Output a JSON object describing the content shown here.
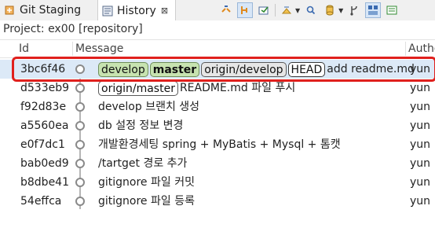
{
  "tabs": [
    {
      "label": "Git Staging"
    },
    {
      "label": "History",
      "close": "⊠"
    }
  ],
  "project": {
    "text": "Project: ex00 [repository]"
  },
  "table": {
    "columns": {
      "id": "Id",
      "message": "Message",
      "author": "Autho"
    },
    "rows": [
      {
        "id": "3bc6f46",
        "message": "add readme.md",
        "author": "yun"
      },
      {
        "id": "d533eb9",
        "message": "README.md 파일 푸시",
        "author": "yun"
      },
      {
        "id": "f92d83e",
        "message": "develop 브랜치 생성",
        "author": "yun"
      },
      {
        "id": "a5560ea",
        "message": "db 설정 정보 변경",
        "author": "yun"
      },
      {
        "id": "e0f7dc1",
        "message": "개발환경세팅  spring + MyBatis + Mysql + 톰캣",
        "author": "yun"
      },
      {
        "id": "bab0ed9",
        "message": "/tartget 경로 추가",
        "author": "yun"
      },
      {
        "id": "b8dbe41",
        "message": "gitignore 파일 커밋",
        "author": "yun"
      },
      {
        "id": "54effca",
        "message": "gitignore 파일 등록",
        "author": "yun"
      }
    ],
    "refs": {
      "row0": [
        "develop",
        "master",
        "origin/develop",
        "HEAD"
      ],
      "row1": [
        "origin/master"
      ]
    }
  },
  "colors": {
    "highlight": "#e0201d",
    "local_ref": "#c7e3b0",
    "selection": "#dce9f7"
  }
}
